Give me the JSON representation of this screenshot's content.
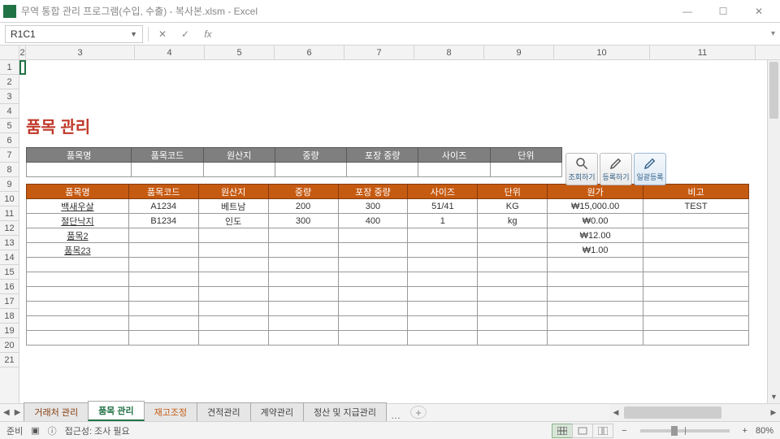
{
  "window": {
    "title": "무역 통합 관리 프로그램(수입, 수출) - 복사본.xlsm - Excel"
  },
  "formula": {
    "namebox": "R1C1",
    "fx": "fx"
  },
  "columns": [
    "2",
    "3",
    "4",
    "5",
    "6",
    "7",
    "8",
    "9",
    "10",
    "11"
  ],
  "rows_small": [
    "1",
    "2",
    "3",
    "4",
    "5",
    "6",
    "7",
    "8",
    "9",
    "10",
    "11",
    "12",
    "13",
    "14",
    "15",
    "16",
    "17",
    "18",
    "19",
    "20",
    "21"
  ],
  "page": {
    "title": "품목 관리"
  },
  "filter_headers": [
    "품목명",
    "품목코드",
    "원산지",
    "중량",
    "포장 중량",
    "사이즈",
    "단위"
  ],
  "actions": {
    "search": "조회하기",
    "register": "등록하기",
    "bulk": "일괄등록"
  },
  "data_headers": [
    "품목명",
    "품목코드",
    "원산지",
    "중량",
    "포장 중량",
    "사이즈",
    "단위",
    "원가",
    "비고"
  ],
  "data_rows": [
    {
      "name": "백새우살",
      "code": "A1234",
      "origin": "베트남",
      "weight": "200",
      "pack": "300",
      "size": "51/41",
      "unit": "KG",
      "price": "₩15,000.00",
      "note": "TEST"
    },
    {
      "name": "절단낙지",
      "code": "B1234",
      "origin": "인도",
      "weight": "300",
      "pack": "400",
      "size": "1",
      "unit": "kg",
      "price": "₩0.00",
      "note": ""
    },
    {
      "name": "품목2",
      "code": "",
      "origin": "",
      "weight": "",
      "pack": "",
      "size": "",
      "unit": "",
      "price": "₩12.00",
      "note": ""
    },
    {
      "name": "품목23",
      "code": "",
      "origin": "",
      "weight": "",
      "pack": "",
      "size": "",
      "unit": "",
      "price": "₩1.00",
      "note": ""
    },
    {
      "name": "",
      "code": "",
      "origin": "",
      "weight": "",
      "pack": "",
      "size": "",
      "unit": "",
      "price": "",
      "note": ""
    },
    {
      "name": "",
      "code": "",
      "origin": "",
      "weight": "",
      "pack": "",
      "size": "",
      "unit": "",
      "price": "",
      "note": ""
    },
    {
      "name": "",
      "code": "",
      "origin": "",
      "weight": "",
      "pack": "",
      "size": "",
      "unit": "",
      "price": "",
      "note": ""
    },
    {
      "name": "",
      "code": "",
      "origin": "",
      "weight": "",
      "pack": "",
      "size": "",
      "unit": "",
      "price": "",
      "note": ""
    },
    {
      "name": "",
      "code": "",
      "origin": "",
      "weight": "",
      "pack": "",
      "size": "",
      "unit": "",
      "price": "",
      "note": ""
    },
    {
      "name": "",
      "code": "",
      "origin": "",
      "weight": "",
      "pack": "",
      "size": "",
      "unit": "",
      "price": "",
      "note": ""
    }
  ],
  "sheet_tabs": [
    "거래처 관리",
    "품목 관리",
    "재고조정",
    "견적관리",
    "계약관리",
    "정산 및 지급관리"
  ],
  "tab_more": "…",
  "status": {
    "ready": "준비",
    "access": "접근성: 조사 필요",
    "zoom": "80%",
    "minus": "−",
    "plus": "+"
  }
}
